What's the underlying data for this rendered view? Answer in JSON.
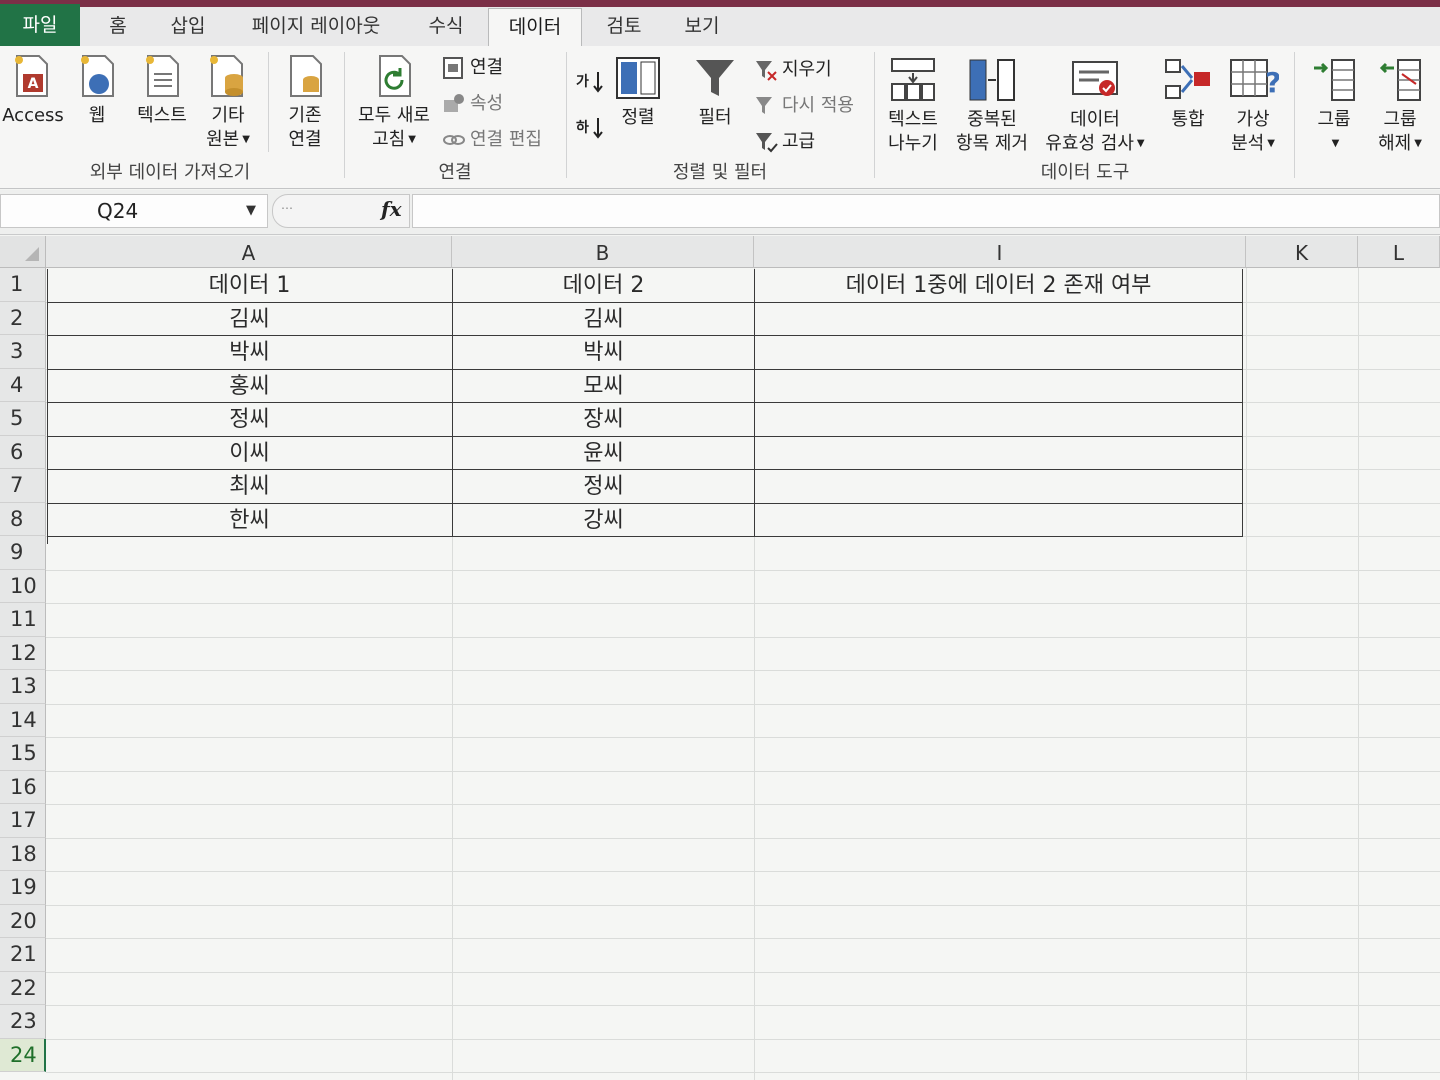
{
  "tabs": [
    {
      "label": "파일"
    },
    {
      "label": "홈"
    },
    {
      "label": "삽입"
    },
    {
      "label": "페이지 레이아웃"
    },
    {
      "label": "수식"
    },
    {
      "label": "데이터"
    },
    {
      "label": "검토"
    },
    {
      "label": "보기"
    }
  ],
  "ribbon": {
    "external": {
      "access": "Access",
      "web": "웹",
      "text": "텍스트",
      "other_line1": "기타",
      "other_line2": "원본",
      "label": "외부 데이터 가져오기"
    },
    "existing": {
      "line1": "기존",
      "line2": "연결"
    },
    "connections": {
      "refresh_line1": "모두 새로",
      "refresh_line2": "고침",
      "connections": "연결",
      "properties": "속성",
      "edit_links": "연결 편집",
      "label": "연결"
    },
    "sortfilter": {
      "sort": "정렬",
      "filter": "필터",
      "clear": "지우기",
      "reapply": "다시 적용",
      "advanced": "고급",
      "label": "정렬 및 필터"
    },
    "datatools": {
      "text_to_columns_line1": "텍스트",
      "text_to_columns_line2": "나누기",
      "remove_dup_line1": "중복된",
      "remove_dup_line2": "항목 제거",
      "validation_line1": "데이터",
      "validation_line2": "유효성 검사",
      "consolidate": "통합",
      "whatif_line1": "가상",
      "whatif_line2": "분석",
      "label": "데이터 도구"
    },
    "outline": {
      "group": "그룹",
      "ungroup_line1": "그룹",
      "ungroup_line2": "해제"
    }
  },
  "namebox": "Q24",
  "columns": [
    "A",
    "B",
    "I",
    "K",
    "L"
  ],
  "rows": [
    "1",
    "2",
    "3",
    "4",
    "5",
    "6",
    "7",
    "8",
    "9",
    "10",
    "11",
    "12",
    "13",
    "14",
    "15",
    "16",
    "17",
    "18",
    "19",
    "20",
    "21",
    "22",
    "23",
    "24"
  ],
  "table": {
    "headers": [
      "데이터 1",
      "데이터 2",
      "데이터 1중에 데이터 2 존재 여부"
    ],
    "col_a": [
      "김씨",
      "박씨",
      "홍씨",
      "정씨",
      "이씨",
      "최씨",
      "한씨"
    ],
    "col_b": [
      "김씨",
      "박씨",
      "모씨",
      "장씨",
      "윤씨",
      "정씨",
      "강씨"
    ],
    "col_i": [
      "",
      "",
      "",
      "",
      "",
      "",
      ""
    ]
  },
  "colors": {
    "accent": "#217346",
    "title_bar": "#7b2f47"
  }
}
